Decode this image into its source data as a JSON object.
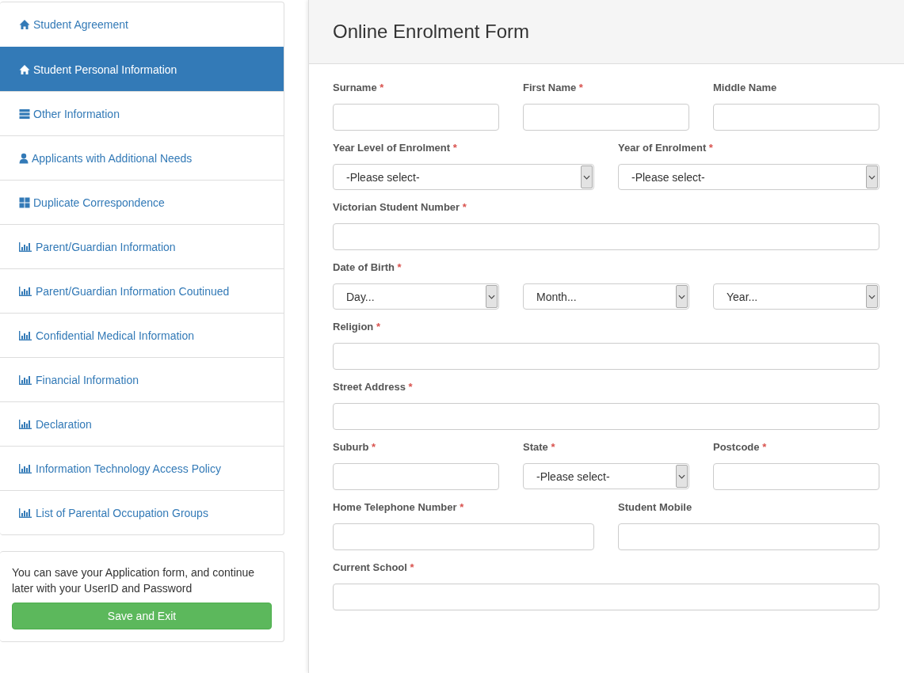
{
  "sidebar": {
    "items": [
      {
        "label": "Student Agreement",
        "kind": "home",
        "selected": false
      },
      {
        "label": "Student Personal Information",
        "kind": "home",
        "selected": true
      },
      {
        "label": "Other Information",
        "kind": "server",
        "selected": false
      },
      {
        "label": "Applicants with Additional Needs",
        "kind": "user",
        "selected": false
      },
      {
        "label": "Duplicate Correspondence",
        "kind": "grid",
        "selected": false
      },
      {
        "label": "Parent/Guardian Information",
        "kind": "chart",
        "selected": false
      },
      {
        "label": "Parent/Guardian Information Coutinued",
        "kind": "chart",
        "selected": false
      },
      {
        "label": "Confidential Medical Information",
        "kind": "chart",
        "selected": false
      },
      {
        "label": "Financial Information",
        "kind": "chart",
        "selected": false
      },
      {
        "label": "Declaration",
        "kind": "chart",
        "selected": false
      },
      {
        "label": "Information Technology Access Policy",
        "kind": "chart",
        "selected": false
      },
      {
        "label": "List of Parental Occupation Groups",
        "kind": "chart",
        "selected": false
      }
    ],
    "save_note": "You can save your Application form, and continue later with your UserID and Password",
    "save_button": "Save and Exit"
  },
  "form": {
    "title": "Online Enrolment Form",
    "required_mark": "*",
    "rows": [
      [
        {
          "label": "Surname",
          "required": true,
          "kind": "text"
        },
        {
          "label": "First Name",
          "required": true,
          "kind": "text"
        },
        {
          "label": "Middle Name",
          "required": false,
          "kind": "text"
        }
      ],
      [
        {
          "label": "Year Level of Enrolment",
          "required": true,
          "kind": "select",
          "value": "-Please select-"
        },
        {
          "label": "Year of Enrolment",
          "required": true,
          "kind": "select",
          "value": "-Please select-"
        }
      ],
      [
        {
          "label": "Victorian Student Number",
          "required": true,
          "kind": "text"
        }
      ],
      [
        {
          "label": "Date of Birth",
          "required": true,
          "kind": "selects",
          "values": [
            "Day...",
            "Month...",
            "Year..."
          ]
        }
      ],
      [
        {
          "label": "Religion",
          "required": true,
          "kind": "text"
        }
      ],
      [
        {
          "label": "Street Address",
          "required": true,
          "kind": "text"
        }
      ],
      [
        {
          "label": "Suburb",
          "required": true,
          "kind": "text"
        },
        {
          "label": "State",
          "required": true,
          "kind": "select",
          "value": "-Please select-"
        },
        {
          "label": "Postcode",
          "required": true,
          "kind": "text"
        }
      ],
      [
        {
          "label": "Home Telephone Number",
          "required": true,
          "kind": "text"
        },
        {
          "label": "Student Mobile",
          "required": false,
          "kind": "text"
        }
      ],
      [
        {
          "label": "Current School",
          "required": true,
          "kind": "text"
        }
      ]
    ]
  }
}
